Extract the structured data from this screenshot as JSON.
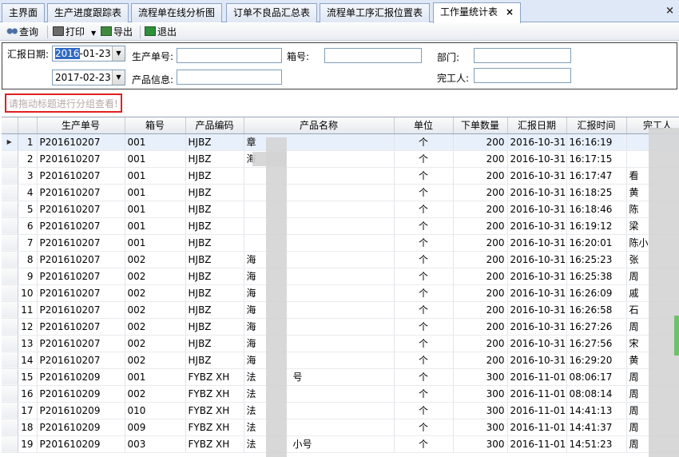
{
  "tabs": [
    {
      "label": "主界面",
      "active": false
    },
    {
      "label": "生产进度跟踪表",
      "active": false
    },
    {
      "label": "流程单在线分析图",
      "active": false
    },
    {
      "label": "订单不良品汇总表",
      "active": false
    },
    {
      "label": "流程单工序汇报位置表",
      "active": false
    },
    {
      "label": "工作量统计表",
      "active": true
    }
  ],
  "toolbar": {
    "query_label": "查询",
    "print_label": "打印",
    "export_label": "导出",
    "exit_label": "退出"
  },
  "filter": {
    "report_date_label": "汇报日期:",
    "date_from_sel": "2016",
    "date_from_rest": "-01-23",
    "date_to": "2017-02-23",
    "order_no_label": "生产单号:",
    "box_no_label": "箱号:",
    "dept_label": "部门:",
    "product_info_label": "产品信息:",
    "finisher_label": "完工人:"
  },
  "group_hint": "请拖动标题进行分组查看!",
  "columns": [
    "生产单号",
    "箱号",
    "产品编码",
    "产品名称",
    "单位",
    "下单数量",
    "汇报日期",
    "汇报时间",
    "完工人"
  ],
  "rows": [
    {
      "n": "1",
      "order": "P201610207",
      "box": "001",
      "code": "HJBZ",
      "name": "章",
      "unit": "个",
      "qty": "200",
      "date": "2016-10-31",
      "time": "16:16:19",
      "worker": ""
    },
    {
      "n": "2",
      "order": "P201610207",
      "box": "001",
      "code": "HJBZ",
      "name": "海",
      "unit": "个",
      "qty": "200",
      "date": "2016-10-31",
      "time": "16:17:15",
      "worker": ""
    },
    {
      "n": "3",
      "order": "P201610207",
      "box": "001",
      "code": "HJBZ",
      "name": "",
      "unit": "个",
      "qty": "200",
      "date": "2016-10-31",
      "time": "16:17:47",
      "worker": "看"
    },
    {
      "n": "4",
      "order": "P201610207",
      "box": "001",
      "code": "HJBZ",
      "name": "",
      "unit": "个",
      "qty": "200",
      "date": "2016-10-31",
      "time": "16:18:25",
      "worker": "黄"
    },
    {
      "n": "5",
      "order": "P201610207",
      "box": "001",
      "code": "HJBZ",
      "name": "",
      "unit": "个",
      "qty": "200",
      "date": "2016-10-31",
      "time": "16:18:46",
      "worker": "陈"
    },
    {
      "n": "6",
      "order": "P201610207",
      "box": "001",
      "code": "HJBZ",
      "name": "",
      "unit": "个",
      "qty": "200",
      "date": "2016-10-31",
      "time": "16:19:12",
      "worker": "梁"
    },
    {
      "n": "7",
      "order": "P201610207",
      "box": "001",
      "code": "HJBZ",
      "name": "",
      "unit": "个",
      "qty": "200",
      "date": "2016-10-31",
      "time": "16:20:01",
      "worker": "陈小"
    },
    {
      "n": "8",
      "order": "P201610207",
      "box": "002",
      "code": "HJBZ",
      "name": "海",
      "unit": "个",
      "qty": "200",
      "date": "2016-10-31",
      "time": "16:25:23",
      "worker": "张"
    },
    {
      "n": "9",
      "order": "P201610207",
      "box": "002",
      "code": "HJBZ",
      "name": "海",
      "unit": "个",
      "qty": "200",
      "date": "2016-10-31",
      "time": "16:25:38",
      "worker": "周"
    },
    {
      "n": "10",
      "order": "P201610207",
      "box": "002",
      "code": "HJBZ",
      "name": "海",
      "unit": "个",
      "qty": "200",
      "date": "2016-10-31",
      "time": "16:26:09",
      "worker": "戚"
    },
    {
      "n": "11",
      "order": "P201610207",
      "box": "002",
      "code": "HJBZ",
      "name": "海",
      "unit": "个",
      "qty": "200",
      "date": "2016-10-31",
      "time": "16:26:58",
      "worker": "石"
    },
    {
      "n": "12",
      "order": "P201610207",
      "box": "002",
      "code": "HJBZ",
      "name": "海",
      "unit": "个",
      "qty": "200",
      "date": "2016-10-31",
      "time": "16:27:26",
      "worker": "周"
    },
    {
      "n": "13",
      "order": "P201610207",
      "box": "002",
      "code": "HJBZ",
      "name": "海",
      "unit": "个",
      "qty": "200",
      "date": "2016-10-31",
      "time": "16:27:56",
      "worker": "宋"
    },
    {
      "n": "14",
      "order": "P201610207",
      "box": "002",
      "code": "HJBZ",
      "name": "海",
      "unit": "个",
      "qty": "200",
      "date": "2016-10-31",
      "time": "16:29:20",
      "worker": "黄"
    },
    {
      "n": "15",
      "order": "P201610209",
      "box": "001",
      "code": "FYBZ XH",
      "name": "法",
      "unit": "个",
      "qty": "300",
      "date": "2016-11-01",
      "time": "08:06:17",
      "worker": "周"
    },
    {
      "n": "16",
      "order": "P201610209",
      "box": "002",
      "code": "FYBZ XH",
      "name": "法",
      "unit": "个",
      "qty": "300",
      "date": "2016-11-01",
      "time": "08:08:14",
      "worker": "周"
    },
    {
      "n": "17",
      "order": "P201610209",
      "box": "010",
      "code": "FYBZ XH",
      "name": "法",
      "unit": "个",
      "qty": "300",
      "date": "2016-11-01",
      "time": "14:41:13",
      "worker": "周"
    },
    {
      "n": "18",
      "order": "P201610209",
      "box": "009",
      "code": "FYBZ XH",
      "name": "法",
      "unit": "个",
      "qty": "300",
      "date": "2016-11-01",
      "time": "14:41:37",
      "worker": "周"
    },
    {
      "n": "19",
      "order": "P201610209",
      "box": "003",
      "code": "FYBZ XH",
      "name": "法",
      "unit": "个",
      "qty": "300",
      "date": "2016-11-01",
      "time": "14:51:23",
      "worker": "周"
    }
  ],
  "extra_name_text": {
    "row15": "号",
    "row19": "小号"
  },
  "row_indicator": "▶",
  "close_icon_glyph": "×",
  "dropdown_glyph": "▼"
}
